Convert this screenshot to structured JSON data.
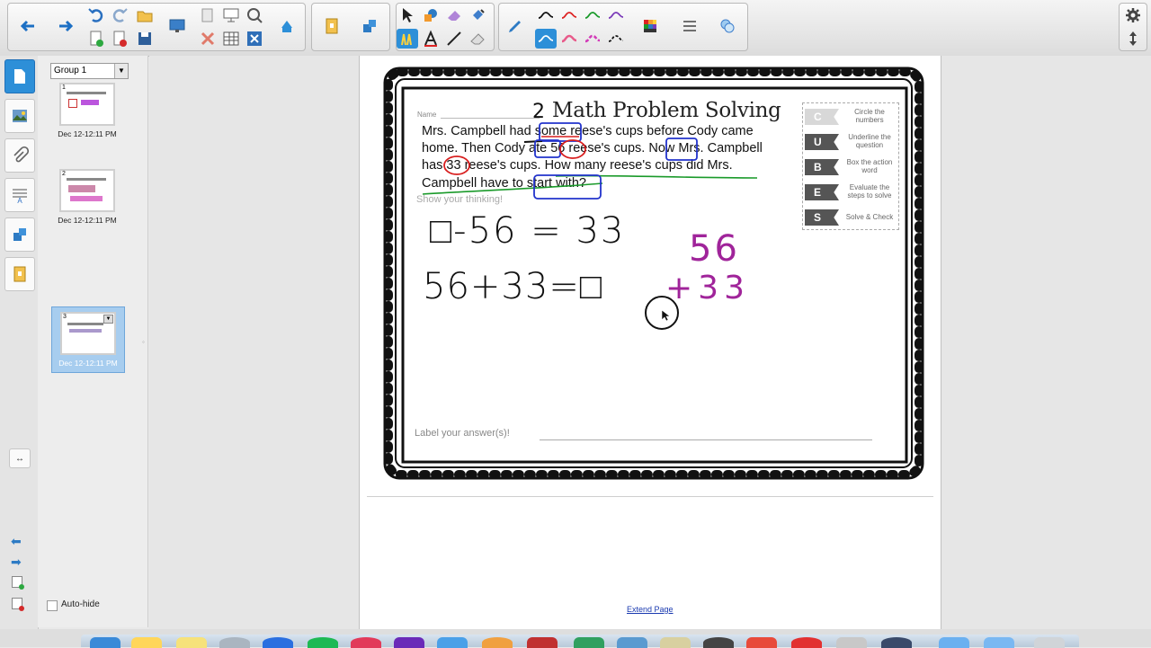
{
  "sidebar": {
    "group_label": "Group 1",
    "pages": [
      {
        "number": "1",
        "timestamp": "Dec 12-12:11 PM"
      },
      {
        "number": "2",
        "timestamp": "Dec 12-12:11 PM"
      },
      {
        "number": "3",
        "timestamp": "Dec 12-12:11 PM"
      }
    ],
    "auto_hide_label": "Auto-hide"
  },
  "worksheet": {
    "title": "Math Problem Solving",
    "name_label": "Name",
    "problem_line1": "Mrs. Campbell had some reese's cups before Cody came",
    "problem_line2": "home. Then Cody ate 56 reese's cups. Now Mrs. Campbell",
    "problem_line3": "has 33 reese's cups. How many reese's cups did Mrs.",
    "problem_line4": "Campbell have to start with?",
    "show_thinking": "Show your thinking!",
    "label_answer": "Label your answer(s)!",
    "steps": [
      {
        "letter": "C",
        "text": "Circle the numbers"
      },
      {
        "letter": "U",
        "text": "Underline the question"
      },
      {
        "letter": "B",
        "text": "Box the action word"
      },
      {
        "letter": "E",
        "text": "Evaluate the steps to solve"
      },
      {
        "letter": "S",
        "text": "Solve & Check"
      }
    ]
  },
  "handwriting": {
    "number_label": "2",
    "equation1": "□-56 = 33",
    "equation2": "56+33=□",
    "vertical_top": "56",
    "vertical_bottom": "+33"
  },
  "extend_page_link": "Extend Page",
  "colors": {
    "accent_blue": "#2d8fd8",
    "ink_black": "#111111",
    "ink_purple": "#a0249a",
    "ink_red": "#d81e1e",
    "ink_blue": "#2233cc",
    "ink_green": "#1a9a2a"
  }
}
